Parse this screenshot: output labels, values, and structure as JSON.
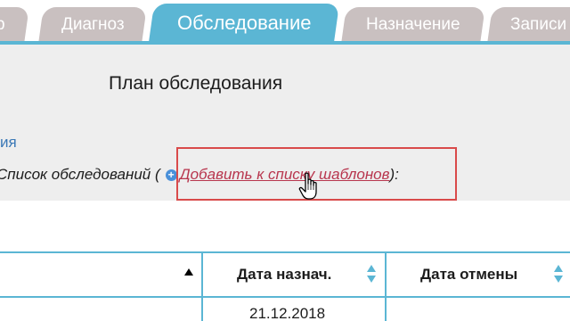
{
  "tabs": [
    {
      "label": "р",
      "active": false
    },
    {
      "label": "Диагноз",
      "active": false
    },
    {
      "label": "Обследование",
      "active": true
    },
    {
      "label": "Назначение",
      "active": false
    },
    {
      "label": "Записи",
      "active": false
    }
  ],
  "plan": {
    "title": "План обследования",
    "cut_link": "ия"
  },
  "list": {
    "label": "Список обследований (",
    "add_link": "Добавить к списку шаблонов",
    "suffix": "):"
  },
  "table": {
    "columns": [
      {
        "label": "",
        "sort": "asc"
      },
      {
        "label": "Дата назнач.",
        "sort": "both"
      },
      {
        "label": "Дата отмены",
        "sort": "both"
      }
    ],
    "rows": [
      {
        "date_assigned": "21.12.2018",
        "date_cancelled": ""
      }
    ]
  },
  "colors": {
    "accent": "#5bb6d4",
    "tab_inactive": "#c9c0c0",
    "highlight": "#d94a4a",
    "link": "#b8364e"
  },
  "icons": [
    "plus-circle-icon",
    "hand-pointer-icon",
    "sort-asc-icon",
    "sort-both-icon"
  ]
}
